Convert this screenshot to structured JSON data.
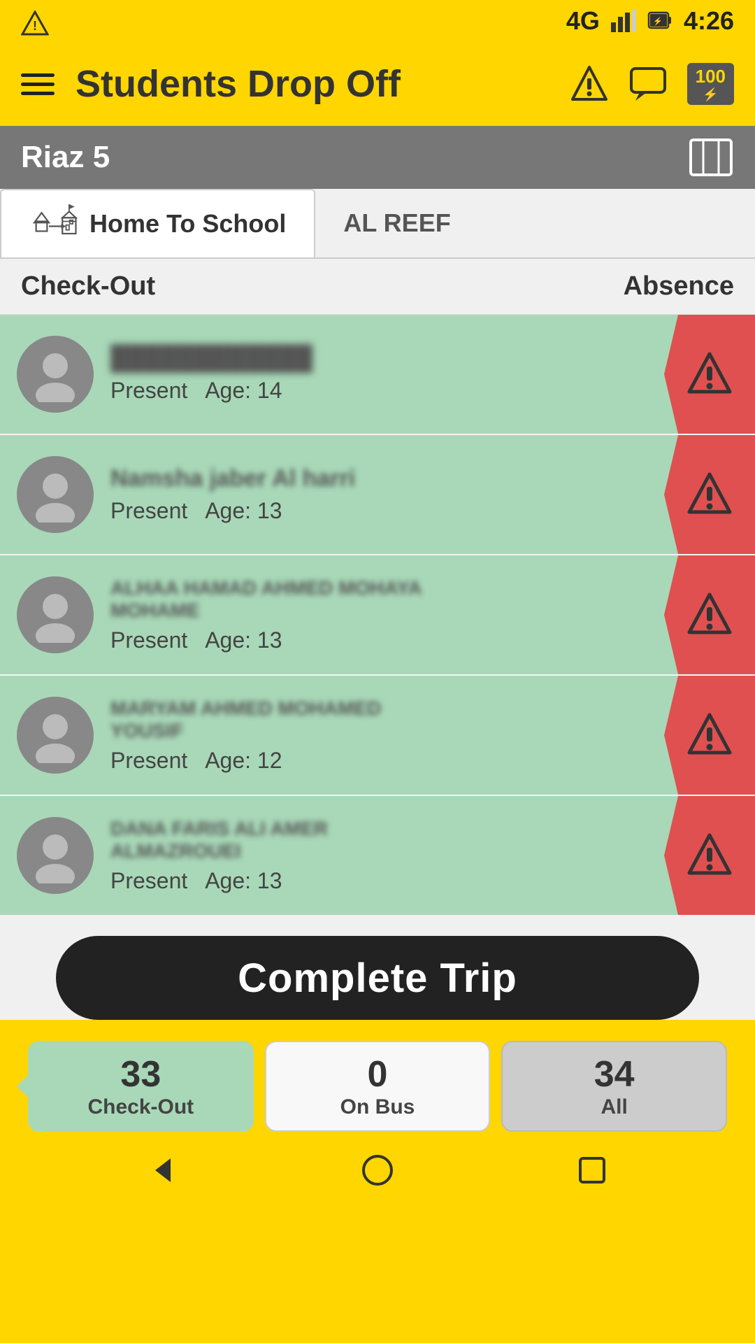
{
  "statusBar": {
    "network": "4G",
    "time": "4:26",
    "battery": "100"
  },
  "header": {
    "title": "Students Drop Off",
    "score": "100"
  },
  "route": {
    "name": "Riaz 5"
  },
  "tabs": [
    {
      "id": "home-to-school",
      "label": "Home To School",
      "active": true
    },
    {
      "id": "al-reef",
      "label": "AL REEF",
      "active": false
    }
  ],
  "columns": {
    "left": "Check-Out",
    "right": "Absence"
  },
  "students": [
    {
      "id": 1,
      "name": "████████████████",
      "status": "Present",
      "age": 14,
      "hasAbsence": true
    },
    {
      "id": 2,
      "name": "Namsha jaber Al harri",
      "status": "Present",
      "age": 13,
      "hasAbsence": true
    },
    {
      "id": 3,
      "name": "ALHAA HAMAD AHMED MOHAYA MOHAME",
      "status": "Present",
      "age": 13,
      "hasAbsence": true
    },
    {
      "id": 4,
      "name": "MARYAM AHMED MOHAMED YOUSIF",
      "status": "Present",
      "age": 12,
      "hasAbsence": true
    },
    {
      "id": 5,
      "name": "DANA FARIS ALI AMER ALMAZROUEI",
      "status": "Present",
      "age": 13,
      "hasAbsence": true
    }
  ],
  "completeTripButton": "Complete Trip",
  "stats": [
    {
      "id": "checkout",
      "number": "33",
      "label": "Check-Out",
      "type": "checkout"
    },
    {
      "id": "onbus",
      "number": "0",
      "label": "On Bus",
      "type": "onbus"
    },
    {
      "id": "all",
      "number": "34",
      "label": "All",
      "type": "all"
    }
  ],
  "nav": {
    "back": "◁",
    "home": "○",
    "square": "□"
  }
}
